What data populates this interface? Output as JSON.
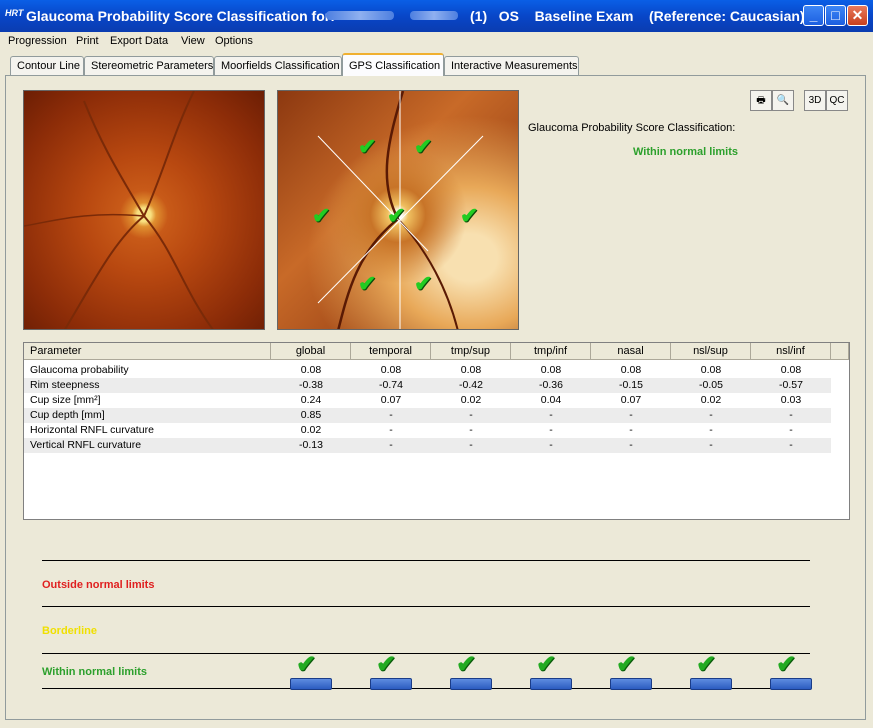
{
  "window": {
    "icon": "HRT",
    "title_prefix": "Glaucoma Probability Score Classification for:",
    "title_suffix": "(1)   OS    Baseline Exam    (Reference: Caucasian)",
    "minimize": "_",
    "maximize": "□",
    "close": "✕"
  },
  "menu": [
    {
      "label": "Progression"
    },
    {
      "label": "Print"
    },
    {
      "label": "Export Data"
    },
    {
      "label": "View"
    },
    {
      "label": "Options"
    }
  ],
  "tabs": [
    {
      "label": "Contour Line"
    },
    {
      "label": "Stereometric Parameters"
    },
    {
      "label": "Moorfields Classification"
    },
    {
      "label": "GPS Classification"
    },
    {
      "label": "Interactive Measurements"
    }
  ],
  "toolbar": {
    "print": "🖶",
    "preview": "🔍",
    "btn_3d": "3D",
    "btn_qc": "QC"
  },
  "gps": {
    "label": "Glaucoma Probability Score Classification:",
    "result": "Within normal limits"
  },
  "table": {
    "headers": [
      "Parameter",
      "global",
      "temporal",
      "tmp/sup",
      "tmp/inf",
      "nasal",
      "nsl/sup",
      "nsl/inf"
    ],
    "rows": [
      [
        "Glaucoma probability",
        "0.08",
        "0.08",
        "0.08",
        "0.08",
        "0.08",
        "0.08",
        "0.08"
      ],
      [
        "Rim steepness",
        "-0.38",
        "-0.74",
        "-0.42",
        "-0.36",
        "-0.15",
        "-0.05",
        "-0.57"
      ],
      [
        "Cup size [mm²]",
        "0.24",
        "0.07",
        "0.02",
        "0.04",
        "0.07",
        "0.02",
        "0.03"
      ],
      [
        "Cup depth [mm]",
        "0.85",
        "-",
        "-",
        "-",
        "-",
        "-",
        "-"
      ],
      [
        "Horizontal RNFL curvature",
        "0.02",
        "-",
        "-",
        "-",
        "-",
        "-",
        "-"
      ],
      [
        "Vertical RNFL curvature",
        "-0.13",
        "-",
        "-",
        "-",
        "-",
        "-",
        "-"
      ]
    ]
  },
  "legend": {
    "outside": "Outside normal limits",
    "borderline": "Borderline",
    "within": "Within normal limits",
    "colors": {
      "outside": "#e02020",
      "borderline": "#f0e000",
      "within": "#2ca02c"
    }
  },
  "check_glyph": "✔"
}
